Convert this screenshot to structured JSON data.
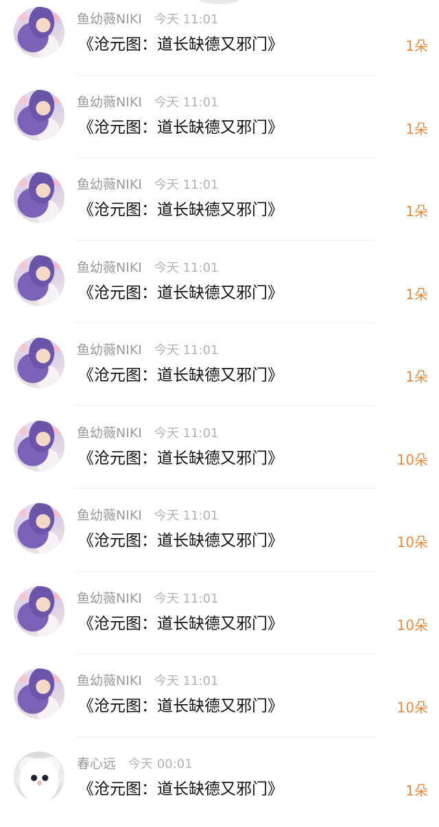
{
  "items": [
    {
      "avatar": "anime-girl-avatar",
      "name": "鱼幼薇NIKI",
      "time": "今天 11:01",
      "message": "《沧元图：道长缺德又邪门》",
      "count": "1朵"
    },
    {
      "avatar": "anime-girl-avatar",
      "name": "鱼幼薇NIKI",
      "time": "今天 11:01",
      "message": "《沧元图：道长缺德又邪门》",
      "count": "1朵"
    },
    {
      "avatar": "anime-girl-avatar",
      "name": "鱼幼薇NIKI",
      "time": "今天 11:01",
      "message": "《沧元图：道长缺德又邪门》",
      "count": "1朵"
    },
    {
      "avatar": "anime-girl-avatar",
      "name": "鱼幼薇NIKI",
      "time": "今天 11:01",
      "message": "《沧元图：道长缺德又邪门》",
      "count": "1朵"
    },
    {
      "avatar": "anime-girl-avatar",
      "name": "鱼幼薇NIKI",
      "time": "今天 11:01",
      "message": "《沧元图：道长缺德又邪门》",
      "count": "1朵"
    },
    {
      "avatar": "anime-girl-avatar",
      "name": "鱼幼薇NIKI",
      "time": "今天 11:01",
      "message": "《沧元图：道长缺德又邪门》",
      "count": "10朵"
    },
    {
      "avatar": "anime-girl-avatar",
      "name": "鱼幼薇NIKI",
      "time": "今天 11:01",
      "message": "《沧元图：道长缺德又邪门》",
      "count": "10朵"
    },
    {
      "avatar": "anime-girl-avatar",
      "name": "鱼幼薇NIKI",
      "time": "今天 11:01",
      "message": "《沧元图：道长缺德又邪门》",
      "count": "10朵"
    },
    {
      "avatar": "anime-girl-avatar",
      "name": "鱼幼薇NIKI",
      "time": "今天 11:01",
      "message": "《沧元图：道长缺德又邪门》",
      "count": "10朵"
    },
    {
      "avatar": "white-cat-avatar",
      "name": "春心远",
      "time": "今天 00:01",
      "message": "《沧元图：道长缺德又邪门》",
      "count": "1朵"
    }
  ],
  "colors": {
    "name": "#9a9a9a",
    "time": "#b3b3b3",
    "message": "#111111",
    "count": "#e8893d",
    "divider": "#f0f0f0"
  }
}
